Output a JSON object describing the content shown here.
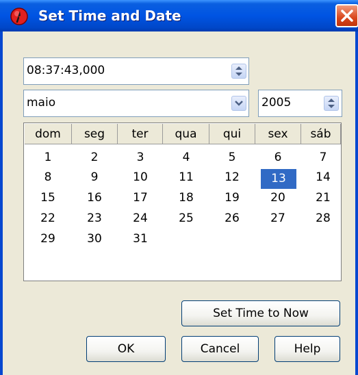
{
  "window": {
    "title": "Set Time and Date",
    "icons": {
      "app": "red-clock-icon",
      "close": "close-icon"
    }
  },
  "time_field": {
    "value": "08:37:43,000"
  },
  "month_select": {
    "value": "maio"
  },
  "year_field": {
    "value": "2005"
  },
  "calendar": {
    "weekday_headers": [
      "dom",
      "seg",
      "ter",
      "qua",
      "qui",
      "sex",
      "sáb"
    ],
    "weeks": [
      [
        "1",
        "2",
        "3",
        "4",
        "5",
        "6",
        "7"
      ],
      [
        "8",
        "9",
        "10",
        "11",
        "12",
        "13",
        "14"
      ],
      [
        "15",
        "16",
        "17",
        "18",
        "19",
        "20",
        "21"
      ],
      [
        "22",
        "23",
        "24",
        "25",
        "26",
        "27",
        "28"
      ],
      [
        "29",
        "30",
        "31",
        "",
        "",
        "",
        ""
      ]
    ],
    "selected_day": "13",
    "selection_color": "#316ac5"
  },
  "buttons": {
    "set_now": "Set Time to Now",
    "ok": "OK",
    "cancel": "Cancel",
    "help": "Help"
  },
  "colors": {
    "titlebar": "#0054e3",
    "dialog_bg": "#ece9d8",
    "close_button": "#d9471d"
  }
}
